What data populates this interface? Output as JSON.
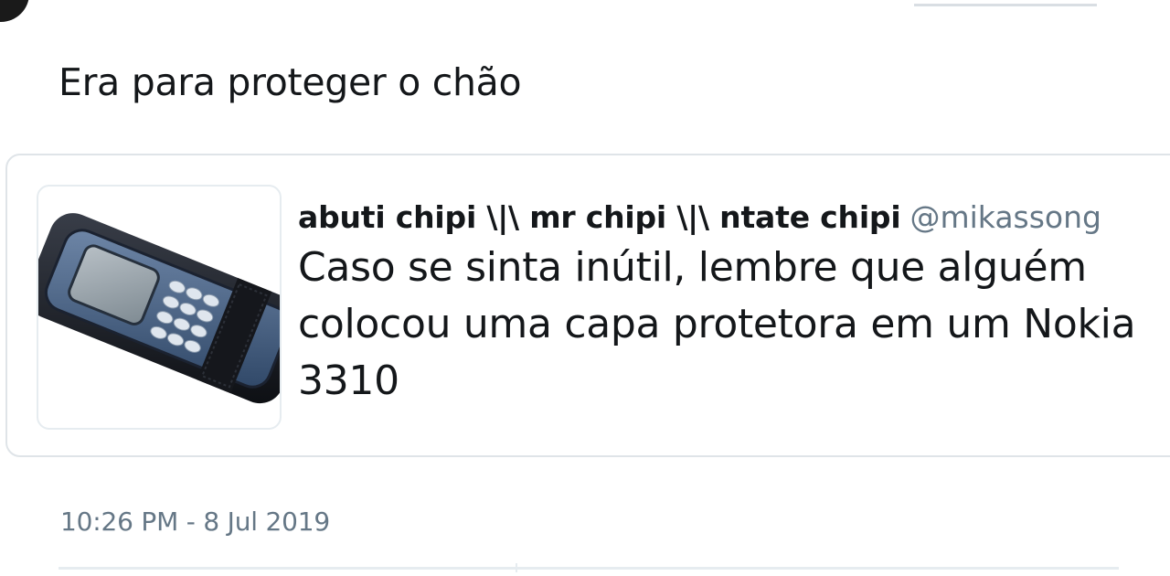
{
  "tweet": {
    "text": "Era para proteger o chão",
    "timestamp": "10:26 PM - 8 Jul 2019"
  },
  "quoted_tweet": {
    "author_name": "abuti chipi \\|\\ mr chipi \\|\\ ntate chipi",
    "author_handle": "@mikassong",
    "text": "Caso se sinta inútil, lembre que alguém colocou uma capa protetora em um Nokia 3310",
    "media": "nokia-phone-in-leather-case"
  },
  "colors": {
    "text": "#14171a",
    "secondary": "#657786",
    "border": "#dfe4e8"
  }
}
